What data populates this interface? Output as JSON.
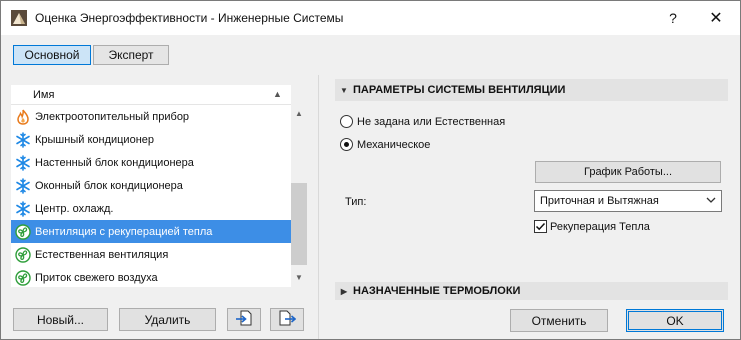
{
  "window": {
    "title": "Оценка Энергоэффективности - Инженерные Системы",
    "help": "?",
    "close": "✕"
  },
  "tabs": [
    {
      "label": "Основной",
      "active": true
    },
    {
      "label": "Эксперт",
      "active": false
    }
  ],
  "list": {
    "header": "Имя",
    "items": [
      {
        "label": "Электроотопительный прибор",
        "icon": "flame-icon"
      },
      {
        "label": "Крышный кондиционер",
        "icon": "snowflake-icon"
      },
      {
        "label": "Настенный блок кондиционера",
        "icon": "snowflake-icon"
      },
      {
        "label": "Оконный блок кондиционера",
        "icon": "snowflake-icon"
      },
      {
        "label": "Центр. охлажд.",
        "icon": "snowflake-icon"
      },
      {
        "label": "Вентиляция с рекуперацией тепла",
        "icon": "fan-icon",
        "selected": true
      },
      {
        "label": "Естественная вентиляция",
        "icon": "fan-icon"
      },
      {
        "label": "Приток свежего воздуха",
        "icon": "fan-icon"
      }
    ]
  },
  "left_buttons": {
    "new": "Новый...",
    "delete": "Удалить"
  },
  "ventilation": {
    "section_title": "ПАРАМЕТРЫ СИСТЕМЫ ВЕНТИЛЯЦИИ",
    "radio_none": "Не задана или Естественная",
    "radio_mech": "Механическое",
    "selected_radio": "mech",
    "schedule_button": "График Работы...",
    "type_label": "Тип:",
    "type_value": "Приточная и Вытяжная",
    "heat_recovery_label": "Рекуперация Тепла",
    "heat_recovery_checked": true
  },
  "thermal_blocks": {
    "section_title": "НАЗНАЧЕННЫЕ ТЕРМОБЛОКИ"
  },
  "footer": {
    "cancel": "Отменить",
    "ok": "OK"
  },
  "colors": {
    "selection": "#3d8ee6",
    "flame": "#e87a1c",
    "snowflake": "#1e88e5",
    "fan": "#2e9e3a",
    "accent": "#0078d7"
  }
}
